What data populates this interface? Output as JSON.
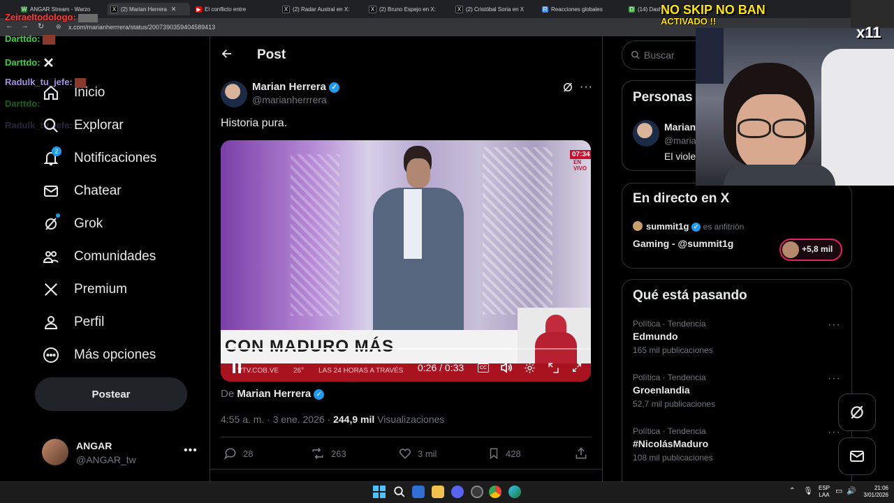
{
  "browser": {
    "tabs": [
      {
        "label": "ANGAR Stream - Warzo",
        "fav": "W"
      },
      {
        "label": "(2) Marian Herrera",
        "fav": "X"
      },
      {
        "label": "El conflicto entre",
        "fav": "▶"
      },
      {
        "label": "(2) Radar Austral en X:",
        "fav": "X"
      },
      {
        "label": "(2) Bruno Espejo en X:",
        "fav": "X"
      },
      {
        "label": "(2) Cristóbal Soria en X",
        "fav": "X"
      },
      {
        "label": "Reacciones globales",
        "fav": "R"
      },
      {
        "label": "(14) Dash",
        "fav": "D"
      }
    ],
    "url": "x.com/marianherrrera/status/2007390359404589413"
  },
  "stream_overlay": {
    "chat": [
      {
        "user": "Zeiraeltodologo:",
        "color": "#ff3b3b"
      },
      {
        "user": "Darttdo:",
        "color": "#3fd14a"
      },
      {
        "user": "Darttdo:",
        "color": "#3fd14a"
      },
      {
        "user": "Radulk_tu_jefe:",
        "color": "#a48fe0"
      },
      {
        "user": "Darttdo:",
        "color": "#3fd14a"
      },
      {
        "user": "Radulk_tu_jefe:",
        "color": "#a48fe0"
      }
    ],
    "banner_line1": "NO SKIP NO BAN",
    "banner_line2": "ACTIVADO !!",
    "multiplier": "x11"
  },
  "sidebar": {
    "items": [
      {
        "label": "Inicio",
        "icon": "home-icon"
      },
      {
        "label": "Explorar",
        "icon": "search-icon"
      },
      {
        "label": "Notificaciones",
        "icon": "bell-icon",
        "badge": "2"
      },
      {
        "label": "Chatear",
        "icon": "mail-icon"
      },
      {
        "label": "Grok",
        "icon": "grok-icon"
      },
      {
        "label": "Comunidades",
        "icon": "communities-icon"
      },
      {
        "label": "Premium",
        "icon": "x-logo-icon"
      },
      {
        "label": "Perfil",
        "icon": "person-icon"
      },
      {
        "label": "Más opciones",
        "icon": "more-circle-icon"
      }
    ],
    "post_button": "Postear",
    "account": {
      "name": "ANGAR",
      "handle": "@ANGAR_tw"
    }
  },
  "post": {
    "header_title": "Post",
    "author": "Marian Herrera",
    "handle": "@marianherrrera",
    "text": "Historia pura.",
    "video": {
      "headline": "CON MADURO MÁS",
      "ticker_site": "VTV.COB.VE",
      "ticker_temp": "26°",
      "ticker_text": "LAS 24 HORAS A TRAVÉS",
      "channel_time": "07:34",
      "channel_live": "EN VIVO",
      "time_current": "0:26",
      "time_total": "0:33",
      "progress": 0.79
    },
    "from_prefix": "De",
    "from_name": "Marian Herrera",
    "timestamp": "4:55 a. m. · 3 ene. 2026 ·",
    "views_count": "244,9 mil",
    "views_label": "Visualizaciones",
    "stats": {
      "replies": "28",
      "reposts": "263",
      "likes": "3 mil",
      "bookmarks": "428"
    }
  },
  "right": {
    "search_placeholder": "Buscar",
    "people_title": "Personas",
    "person_name": "Marian",
    "person_handle": "@maria",
    "person_bio": "El viole",
    "live_title": "En directo en X",
    "live_host": "summit1g",
    "live_host_suffix": "es anfitrión",
    "live_stream_title": "Gaming - @summit1g",
    "live_viewers": "+5,8 mil",
    "trends_title": "Qué está pasando",
    "trends": [
      {
        "meta": "Política · Tendencia",
        "name": "Edmundo",
        "count": "165 mil publicaciones"
      },
      {
        "meta": "Política · Tendencia",
        "name": "Groenlandia",
        "count": "52,7 mil publicaciones"
      },
      {
        "meta": "Política · Tendencia",
        "name": "#NicolásMaduro",
        "count": "108 mil publicaciones"
      }
    ]
  },
  "taskbar": {
    "lang_top": "ESP",
    "lang_bottom": "LAA",
    "time": "21:06",
    "date": "3/01/2026"
  },
  "colors": {
    "accent": "#1d9bf0",
    "background": "#000000",
    "border": "#2f3336",
    "muted": "#71767b"
  }
}
